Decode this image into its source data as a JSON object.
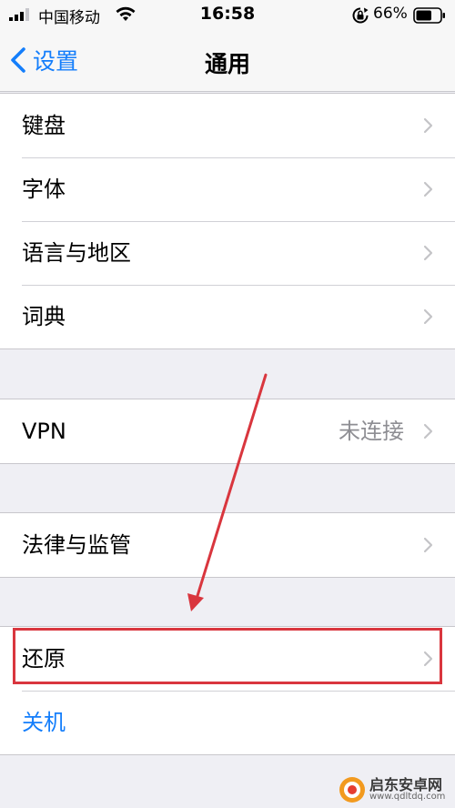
{
  "status_bar": {
    "carrier": "中国移动",
    "time": "16:58",
    "battery_percent": "66%",
    "battery_level": 0.66
  },
  "nav": {
    "back_label": "设置",
    "title": "通用"
  },
  "groups": {
    "keyboard_group": {
      "rows": [
        {
          "label": "键盘"
        },
        {
          "label": "字体"
        },
        {
          "label": "语言与地区"
        },
        {
          "label": "词典"
        }
      ]
    },
    "vpn_group": {
      "rows": [
        {
          "label": "VPN",
          "value": "未连接"
        }
      ]
    },
    "legal_group": {
      "rows": [
        {
          "label": "法律与监管"
        }
      ]
    },
    "reset_group": {
      "rows": [
        {
          "label": "还原"
        },
        {
          "label": "关机"
        }
      ]
    }
  },
  "watermark": {
    "name": "启东安卓网",
    "url": "www.qdltdq.com"
  },
  "colors": {
    "accent": "#147efb",
    "annotation": "#d9363e",
    "background": "#efeff4"
  }
}
